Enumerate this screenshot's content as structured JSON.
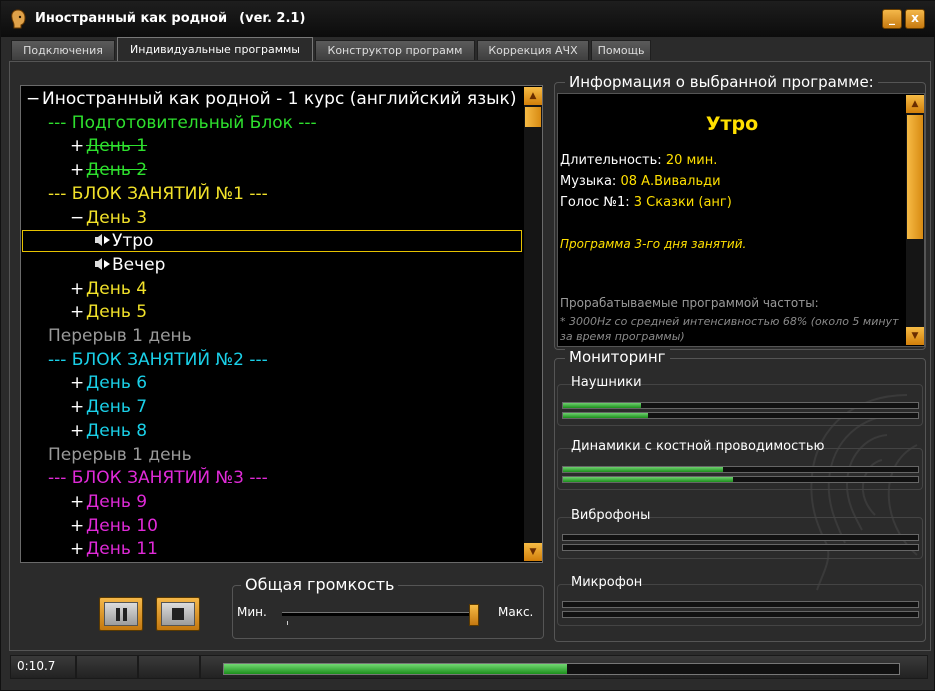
{
  "window": {
    "title": "Иностранный как родной",
    "version": "(ver. 2.1)",
    "minimize_label": "_",
    "close_label": "x"
  },
  "tabs": [
    {
      "label": "Подключения"
    },
    {
      "label": "Индивидуальные программы",
      "active": true
    },
    {
      "label": "Конструктор программ"
    },
    {
      "label": "Коррекция АЧХ"
    },
    {
      "label": "Помощь"
    }
  ],
  "tree": {
    "rows": [
      {
        "text": "Иностранный как родной - 1 курс (английский язык)",
        "exp": "−",
        "color": "white"
      },
      {
        "text": "---  Подготовительный Блок ---",
        "exp": "",
        "color": "green"
      },
      {
        "text": "День 1",
        "exp": "+",
        "color": "green",
        "strike": true
      },
      {
        "text": "День 2",
        "exp": "+",
        "color": "green",
        "strike": true
      },
      {
        "text": "--- БЛОК ЗАНЯТИЙ №1 ---",
        "exp": "",
        "color": "yellow"
      },
      {
        "text": "День 3",
        "exp": "−",
        "color": "yellow"
      },
      {
        "text": "Утро",
        "exp": "",
        "color": "white",
        "icon": "speaker-play-icon",
        "selected": true
      },
      {
        "text": "Вечер",
        "exp": "",
        "color": "white",
        "icon": "speaker-play-icon"
      },
      {
        "text": "День 4",
        "exp": "+",
        "color": "yellow"
      },
      {
        "text": "День 5",
        "exp": "+",
        "color": "yellow"
      },
      {
        "text": "Перерыв 1 день",
        "exp": "",
        "color": "gray"
      },
      {
        "text": "--- БЛОК ЗАНЯТИЙ №2 ---",
        "exp": "",
        "color": "cyan"
      },
      {
        "text": "День 6",
        "exp": "+",
        "color": "cyan"
      },
      {
        "text": "День 7",
        "exp": "+",
        "color": "cyan"
      },
      {
        "text": "День 8",
        "exp": "+",
        "color": "cyan"
      },
      {
        "text": "Перерыв 1 день",
        "exp": "",
        "color": "gray"
      },
      {
        "text": "--- БЛОК ЗАНЯТИЙ №3 ---",
        "exp": "",
        "color": "magenta"
      },
      {
        "text": "День 9",
        "exp": "+",
        "color": "magenta"
      },
      {
        "text": "День 10",
        "exp": "+",
        "color": "magenta"
      },
      {
        "text": "День 11",
        "exp": "+",
        "color": "magenta"
      }
    ]
  },
  "playback": {
    "pause_icon": "pause-icon",
    "stop_icon": "stop-icon"
  },
  "volume": {
    "title": "Общая громкость",
    "min_label": "Мин.",
    "max_label": "Макс.",
    "level_fraction": 1.0
  },
  "info": {
    "title": "Информация о выбранной программе:",
    "program_name": "Утро",
    "duration_label": "Длительность:",
    "duration_value": "20 мин.",
    "music_label": "Музыка:",
    "music_value": "08 А.Вивальди",
    "voice_label": "Голос №1:",
    "voice_value": "3 Сказки (анг)",
    "description": "Программа 3-го дня занятий.",
    "freq_heading": "Прорабатываемые программой частоты:",
    "freq_text": "* 3000Hz со средней интенсивностью 68% (около 5 минут за время программы)"
  },
  "monitoring": {
    "title": "Мониторинг",
    "channels": [
      {
        "label": "Наушники",
        "levels": [
          0.22,
          0.24
        ]
      },
      {
        "label": "Динамики с костной проводимостью",
        "levels": [
          0.45,
          0.48
        ]
      },
      {
        "label": "Виброфоны",
        "levels": [
          0,
          0
        ]
      },
      {
        "label": "Микрофон",
        "levels": [
          0,
          0
        ]
      }
    ]
  },
  "status": {
    "time": "0:10.7",
    "progress_fraction": 0.508
  },
  "colors": {
    "white": "#ffffff",
    "green": "#2ee02e",
    "yellow": "#f2e22a",
    "gray": "#9a9a9a",
    "cyan": "#1ad0e8",
    "magenta": "#e02ad8",
    "accent": "#e39a1e"
  }
}
